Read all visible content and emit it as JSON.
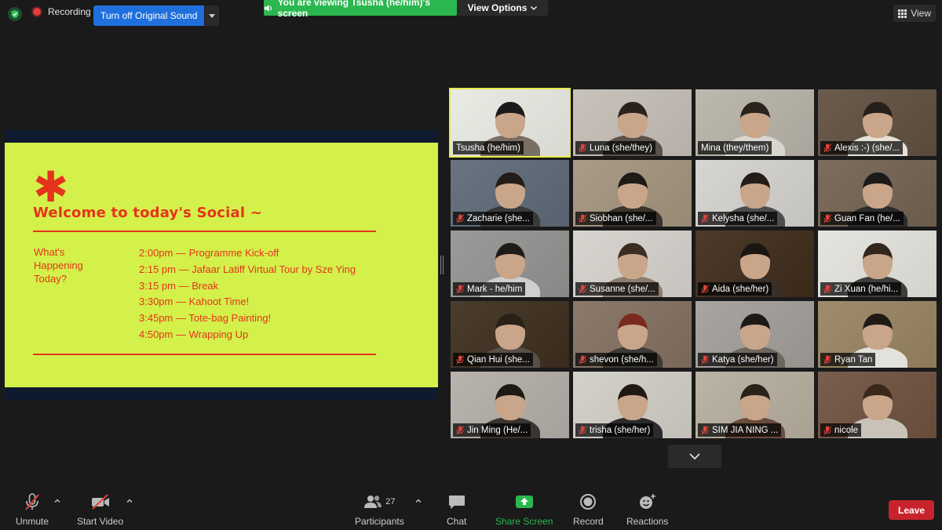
{
  "topbar": {
    "recording_label": "Recording",
    "sound_button": "Turn off Original Sound",
    "viewing_banner": "You are viewing Tsusha (he/him)'s screen",
    "view_options": "View Options",
    "view_button": "View"
  },
  "slide": {
    "title": "Welcome to today's Social ~",
    "side_label": "What's Happening Today?",
    "agenda": [
      "2:00pm — Programme Kick-off",
      "2:15 pm — Jafaar Latiff Virtual Tour by Sze Ying",
      "3:15 pm — Break",
      "3:30pm — Kahoot Time!",
      "3:45pm — Tote-bag Painting!",
      "4:50pm — Wrapping Up"
    ]
  },
  "participants": [
    {
      "name": "Tsusha (he/him)",
      "muted": false
    },
    {
      "name": "Luna (she/they)",
      "muted": true
    },
    {
      "name": "Mina (they/them)",
      "muted": false
    },
    {
      "name": "Alexis :-) (she/...",
      "muted": true
    },
    {
      "name": "Zacharie (she...",
      "muted": true
    },
    {
      "name": "Siobhan (she/...",
      "muted": true
    },
    {
      "name": "Kelysha (she/...",
      "muted": true
    },
    {
      "name": "Guan Fan (he/...",
      "muted": true
    },
    {
      "name": "Mark - he/him",
      "muted": true
    },
    {
      "name": "Susanne (she/...",
      "muted": true
    },
    {
      "name": "Aida (she/her)",
      "muted": true
    },
    {
      "name": "Zi Xuan (he/hi...",
      "muted": true
    },
    {
      "name": "Qian Hui (she...",
      "muted": true
    },
    {
      "name": "shevon (she/h...",
      "muted": true
    },
    {
      "name": "Katya (she/her)",
      "muted": true
    },
    {
      "name": "Ryan Tan",
      "muted": true
    },
    {
      "name": "Jin Ming (He/...",
      "muted": true
    },
    {
      "name": "trisha (she/her)",
      "muted": true
    },
    {
      "name": "SIM JIA NING ...",
      "muted": true
    },
    {
      "name": "nicole",
      "muted": true
    }
  ],
  "toolbar": {
    "unmute": "Unmute",
    "start_video": "Start Video",
    "participants": "Participants",
    "participant_count": "27",
    "chat": "Chat",
    "share_screen": "Share Screen",
    "record": "Record",
    "reactions": "Reactions",
    "leave": "Leave"
  },
  "colors": {
    "slide_bg": "#d4f04a",
    "slide_accent": "#e5341c",
    "share_green": "#2bb74f",
    "leave_red": "#c8232c",
    "active_speaker": "#e8e94a",
    "primary_blue": "#1f6fdc"
  }
}
